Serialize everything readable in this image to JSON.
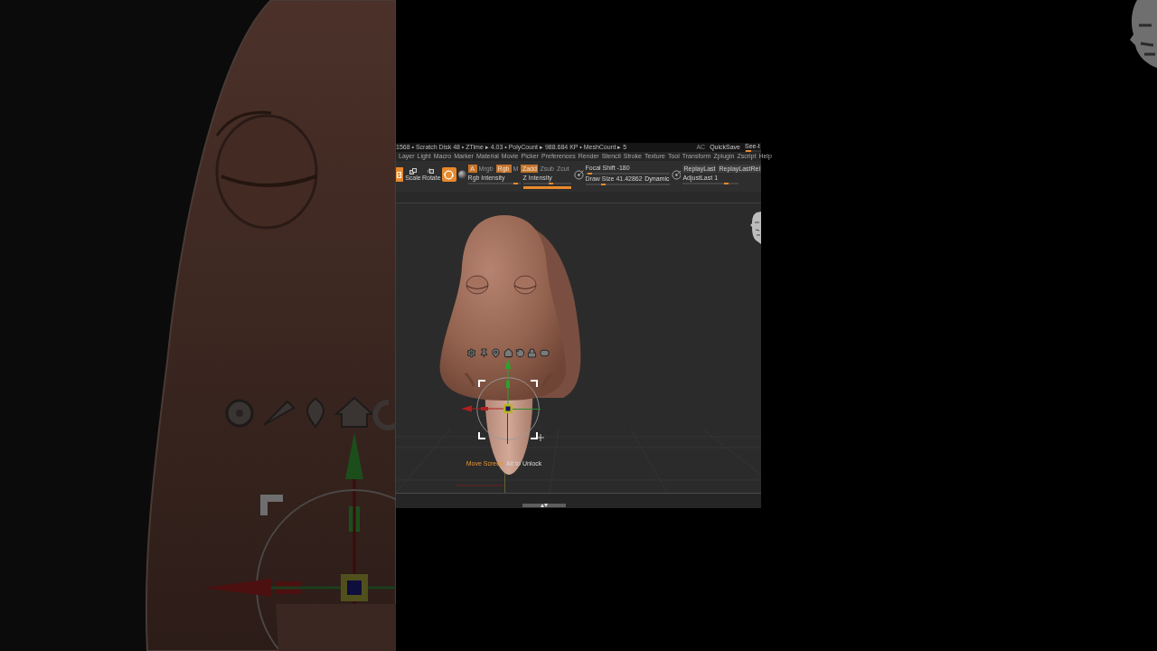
{
  "title_bar": {
    "info": "1568 • Scratch Disk 48 • ZTime ▸ 4.03 • PolyCount ▸ 988.684 KP • MeshCount ▸ 5",
    "items": [
      "AC",
      "QuickSave"
    ],
    "see_through": {
      "label": "See-t",
      "level": 0.05
    }
  },
  "menu": [
    "Layer",
    "Light",
    "Macro",
    "Marker",
    "Material",
    "Movie",
    "Picker",
    "Preferences",
    "Render",
    "Stencil",
    "Stroke",
    "Texture",
    "Tool",
    "Transform",
    "Zplugin",
    "Zscript",
    "Help"
  ],
  "toolbar": {
    "tool_buttons": [
      {
        "kind": "edit",
        "selected": true
      },
      {
        "kind": "scale",
        "label": "Scale",
        "selected": false
      },
      {
        "kind": "rotate",
        "label": "Rotate",
        "selected": false
      },
      {
        "kind": "ring",
        "selected": true
      }
    ],
    "channel_buttons": [
      {
        "label": "A",
        "selected": true
      },
      {
        "label": "Mrgb",
        "selected": false
      },
      {
        "label": "Rgb",
        "selected": true
      },
      {
        "label": "M",
        "selected": false
      },
      {
        "label": "Zadd",
        "selected": true
      },
      {
        "label": "Zsub",
        "selected": false
      },
      {
        "label": "Zcut",
        "selected": false
      }
    ],
    "intensity_sliders": [
      {
        "label": "Rgb Intensity",
        "level": 0.95
      },
      {
        "label": "Z Intensity",
        "level": 0.6
      }
    ],
    "brush_sliders": [
      {
        "label": "Focal Shift",
        "reading": "-180",
        "level": 0.03
      },
      {
        "label": "Draw Size",
        "reading": "41.42862",
        "level": 0.2
      }
    ],
    "dynamic_button": {
      "label": "Dynamic"
    },
    "replay_buttons": [
      "ReplayLast",
      "ReplayLastRel"
    ],
    "adjust_slider": {
      "label": "AdjustLast",
      "reading": "1",
      "level": 0.8
    }
  },
  "viewport": {
    "hint": {
      "action": "Move Screen",
      "instruction": "Alt to Unlock"
    }
  }
}
